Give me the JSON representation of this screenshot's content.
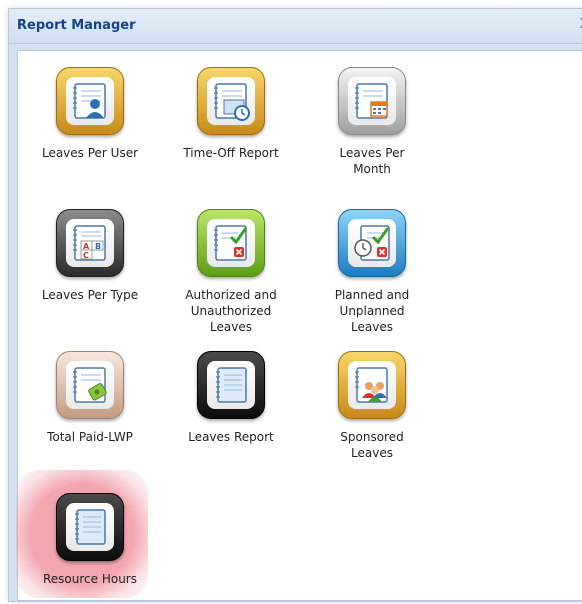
{
  "window": {
    "title": "Report Manager",
    "close_glyph": "X"
  },
  "reports": [
    {
      "label": "Leaves Per User",
      "icon": "user-report-icon",
      "frame_color": "#d9a02f"
    },
    {
      "label": "Time-Off Report",
      "icon": "clock-report-icon",
      "frame_color": "#d9a02f"
    },
    {
      "label": "Leaves Per\nMonth",
      "icon": "calendar-report-icon",
      "frame_color": "#b8b8b8"
    },
    {
      "label": "Leaves Per Type",
      "icon": "abc-report-icon",
      "frame_color": "#5a5a5a"
    },
    {
      "label": "Authorized and\nUnauthorized\nLeaves",
      "icon": "check-cross-report-icon",
      "frame_color": "#7fbf2b"
    },
    {
      "label": "Planned and\nUnplanned\nLeaves",
      "icon": "clock-check-report-icon",
      "frame_color": "#3a9ad9"
    },
    {
      "label": "Total Paid-LWP",
      "icon": "paid-report-icon",
      "frame_color": "#d9b8a2"
    },
    {
      "label": "Leaves Report",
      "icon": "notebook-report-icon",
      "frame_color": "#1a1a1a"
    },
    {
      "label": "Sponsored\nLeaves",
      "icon": "group-report-icon",
      "frame_color": "#d9a02f"
    },
    {
      "label": "Resource Hours",
      "icon": "notebook-report-icon",
      "frame_color": "#1a1a1a",
      "highlighted": true
    }
  ],
  "colors": {
    "title_text": "#15428b",
    "highlight": "#f0969f"
  }
}
